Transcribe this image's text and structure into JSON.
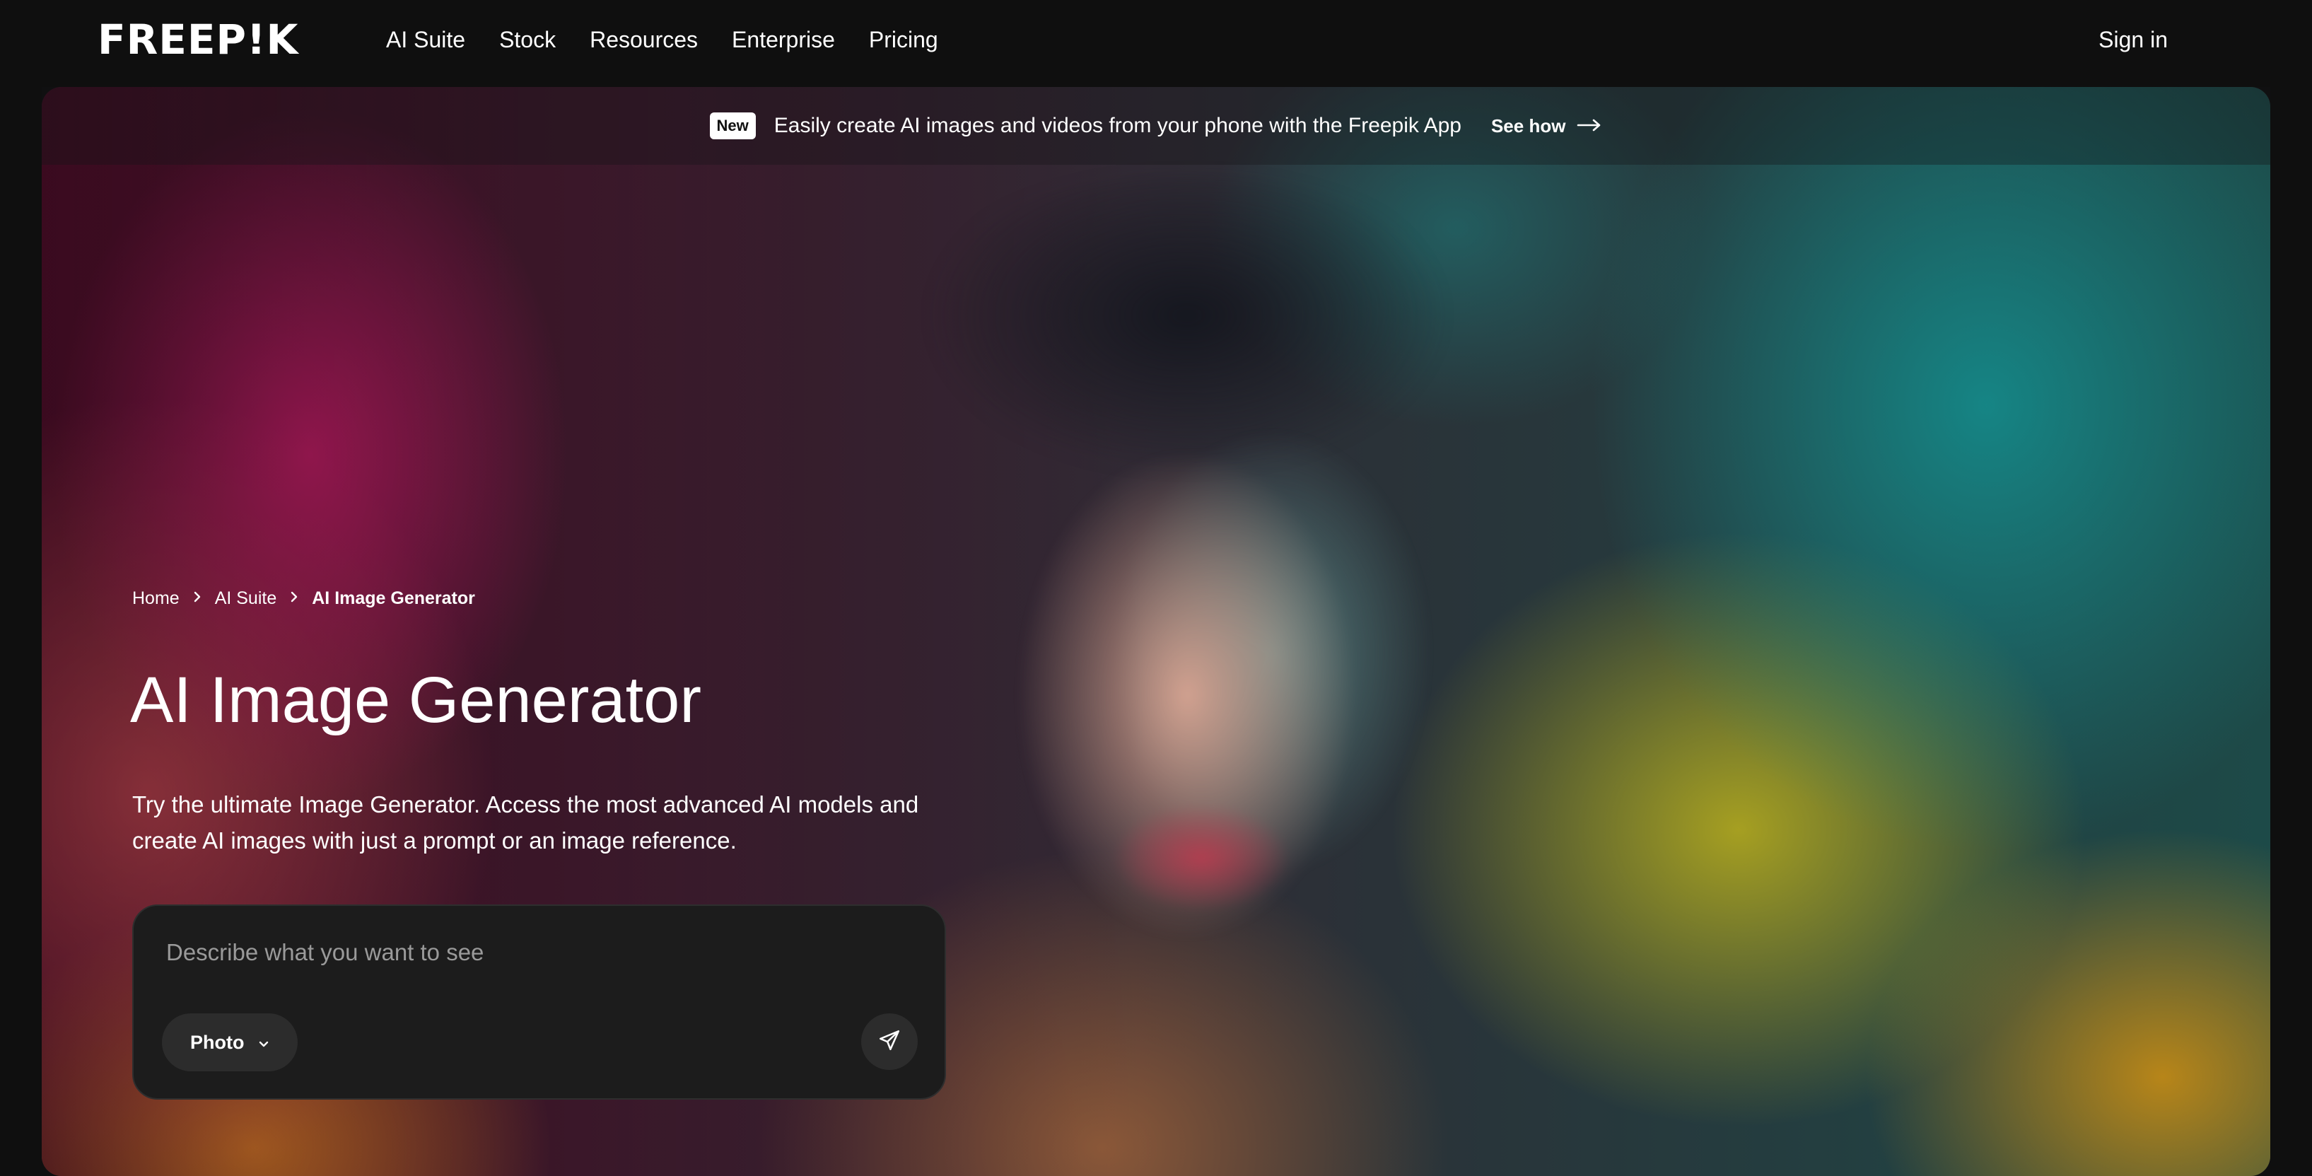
{
  "header": {
    "logo_text": "FREEP!K",
    "nav": [
      {
        "label": "AI Suite"
      },
      {
        "label": "Stock"
      },
      {
        "label": "Resources"
      },
      {
        "label": "Enterprise"
      },
      {
        "label": "Pricing"
      }
    ],
    "signin_label": "Sign in"
  },
  "announcement": {
    "badge": "New",
    "text": "Easily create AI images and videos from your phone with the Freepik App",
    "link_label": "See how",
    "link_icon": "arrow-right-icon"
  },
  "breadcrumb": {
    "items": [
      {
        "label": "Home"
      },
      {
        "label": "AI Suite"
      },
      {
        "label": "AI Image Generator"
      }
    ],
    "separator_icon": "chevron-right-icon"
  },
  "hero": {
    "title": "AI Image Generator",
    "description": "Try the ultimate Image Generator. Access the most advanced AI models and create AI images with just a prompt or an image reference."
  },
  "prompt": {
    "placeholder": "Describe what you want to see",
    "value": "",
    "mode_label": "Photo",
    "mode_icon": "chevron-down-icon",
    "send_icon": "send-icon"
  },
  "colors": {
    "page_background": "#0f0f0f",
    "prompt_background": "#1c1c1c",
    "pill_background": "#2c2c2c",
    "text": "#ffffff",
    "placeholder": "#9a9a9a"
  }
}
